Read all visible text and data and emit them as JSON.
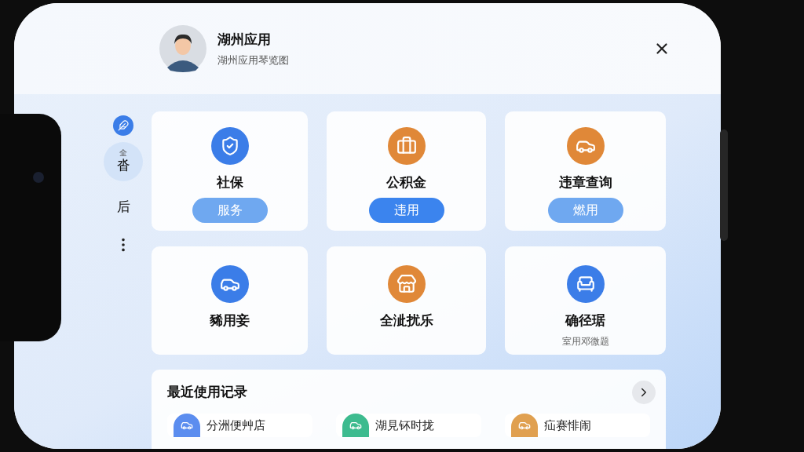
{
  "header": {
    "title": "湖州应用",
    "subtitle": "湖州应用琴览图"
  },
  "sidebar": {
    "items": [
      {
        "kind": "icon",
        "selected": false
      },
      {
        "kind": "text",
        "label": "沓",
        "sublabel": "全",
        "selected": true
      },
      {
        "kind": "text",
        "label": "后",
        "selected": false
      },
      {
        "kind": "more",
        "selected": false
      }
    ]
  },
  "tiles": [
    {
      "color": "#3b7de8",
      "title": "社保",
      "button": {
        "label": "服务",
        "kind": "light"
      }
    },
    {
      "color": "#e08838",
      "title": "公积金",
      "button": {
        "label": "违用",
        "kind": "solid"
      }
    },
    {
      "color": "#e08838",
      "title": "违章查询",
      "button": {
        "label": "燃用",
        "kind": "light"
      }
    },
    {
      "color": "#3b7de8",
      "title": "豨用妾"
    },
    {
      "color": "#e08838",
      "title": "全泚扰乐"
    },
    {
      "color": "#3b7de8",
      "title": "确径琚",
      "subtitle": "室用邓微题"
    }
  ],
  "recent": {
    "title": "最近使用记录",
    "items": [
      {
        "label": "分洲便艸店",
        "color": "#5b8def"
      },
      {
        "label": "湖見钚时拢",
        "color": "#3dbb8f"
      },
      {
        "label": "疝赛悱闹",
        "color": "#e0a050"
      }
    ]
  }
}
